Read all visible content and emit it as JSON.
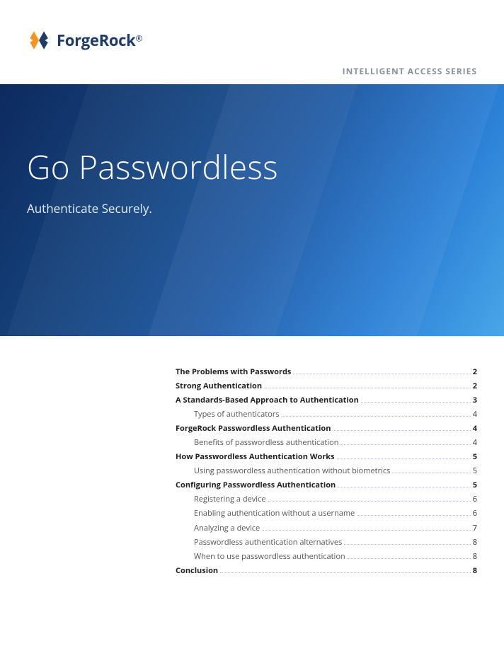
{
  "brand": {
    "name": "ForgeRock",
    "registered": "®"
  },
  "series": "INTELLIGENT ACCESS SERIES",
  "hero": {
    "title": "Go Passwordless",
    "subtitle": "Authenticate Securely."
  },
  "toc": [
    {
      "label": "The Problems with Passwords",
      "page": "2",
      "level": 0
    },
    {
      "label": "Strong Authentication",
      "page": "2",
      "level": 0
    },
    {
      "label": "A Standards-Based Approach to Authentication",
      "page": "3",
      "level": 0
    },
    {
      "label": "Types of authenticators",
      "page": "4",
      "level": 1
    },
    {
      "label": "ForgeRock Passwordless Authentication",
      "page": "4",
      "level": 0
    },
    {
      "label": "Benefits of passwordless authentication",
      "page": "4",
      "level": 1
    },
    {
      "label": "How Passwordless Authentication Works",
      "page": "5",
      "level": 0
    },
    {
      "label": "Using passwordless authentication without biometrics",
      "page": "5",
      "level": 1
    },
    {
      "label": "Configuring Passwordless Authentication",
      "page": "5",
      "level": 0
    },
    {
      "label": "Registering a device",
      "page": "6",
      "level": 1
    },
    {
      "label": "Enabling authentication without a username",
      "page": "6",
      "level": 1
    },
    {
      "label": "Analyzing a device",
      "page": "7",
      "level": 1
    },
    {
      "label": "Passwordless authentication alternatives",
      "page": "8",
      "level": 1
    },
    {
      "label": "When to use passwordless authentication",
      "page": "8",
      "level": 1
    },
    {
      "label": "Conclusion",
      "page": "8",
      "level": 0
    }
  ]
}
